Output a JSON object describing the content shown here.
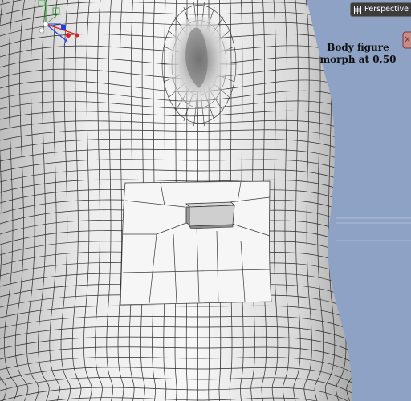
{
  "viewport": {
    "view_label": "Perspective View",
    "view_icon": "grid-view-icon",
    "annotation_line1": "Body figure",
    "annotation_line2": "morph at 0,50",
    "background_color": "#8ea2c6",
    "mesh_color": "#ffffff",
    "wire_color": "#2b2b2b",
    "selection_color": "#ffffff"
  },
  "axis_gizmo": {
    "axes": [
      "x-axis",
      "y-axis",
      "z-axis"
    ],
    "colors": {
      "x": "#e02020",
      "y": "#20a020",
      "z": "#2040e0"
    }
  }
}
